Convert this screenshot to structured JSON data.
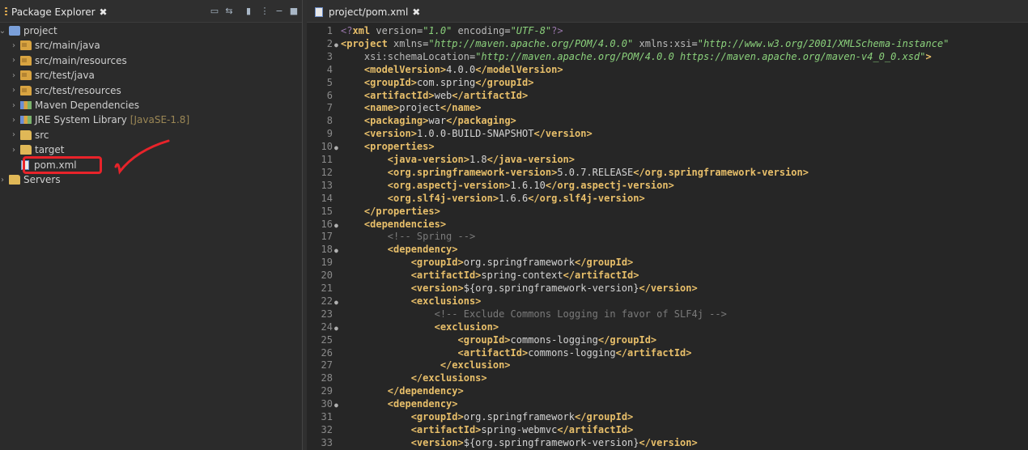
{
  "left_tab": {
    "title": "Package Explorer",
    "close": "✖"
  },
  "tree": [
    {
      "label": "project",
      "level": 0,
      "chev": "⌄",
      "icon": "project-icon"
    },
    {
      "label": "src/main/java",
      "level": 1,
      "chev": "›",
      "icon": "package-folder-icon"
    },
    {
      "label": "src/main/resources",
      "level": 1,
      "chev": "›",
      "icon": "package-folder-icon"
    },
    {
      "label": "src/test/java",
      "level": 1,
      "chev": "›",
      "icon": "package-folder-icon"
    },
    {
      "label": "src/test/resources",
      "level": 1,
      "chev": "›",
      "icon": "package-folder-icon"
    },
    {
      "label": "Maven Dependencies",
      "level": 1,
      "chev": "›",
      "icon": "library-icon"
    },
    {
      "label": "JRE System Library",
      "level": 1,
      "chev": "›",
      "icon": "library-icon",
      "suffix": "[JavaSE-1.8]"
    },
    {
      "label": "src",
      "level": 1,
      "chev": "›",
      "icon": "folder-icon"
    },
    {
      "label": "target",
      "level": 1,
      "chev": "›",
      "icon": "folder-icon"
    },
    {
      "label": "pom.xml",
      "level": 1,
      "chev": "",
      "icon": "xml-file-icon"
    },
    {
      "label": "Servers",
      "level": 0,
      "chev": "›",
      "icon": "servers-folder-icon"
    }
  ],
  "editor_tab": {
    "title": "project/pom.xml",
    "close": "✖"
  },
  "code_lines": [
    {
      "n": "1",
      "fold": false,
      "html": "<span class='pi'>&lt;?</span><span class='xl'>xml</span> <span class='a'>version</span>=<span class='v'>\"1.0\"</span> <span class='a'>encoding</span>=<span class='v'>\"UTF-8\"</span><span class='pi'>?&gt;</span>"
    },
    {
      "n": "2",
      "fold": true,
      "html": "<span class='t'>&lt;project</span> <span class='a'>xmlns</span>=<span class='v'>\"http://maven.apache.org/POM/4.0.0\"</span> <span class='a'>xmlns:xsi</span>=<span class='v'>\"http://www.w3.org/2001/XMLSchema-instance\"</span>"
    },
    {
      "n": "3",
      "fold": false,
      "html": "    <span class='a'>xsi:schemaLocation</span>=<span class='v'>\"http://maven.apache.org/POM/4.0.0 https://maven.apache.org/maven-v4_0_0.xsd\"</span><span class='t'>&gt;</span>"
    },
    {
      "n": "4",
      "fold": false,
      "html": "    <span class='t'>&lt;modelVersion&gt;</span>4.0.0<span class='t'>&lt;/modelVersion&gt;</span>"
    },
    {
      "n": "5",
      "fold": false,
      "html": "    <span class='t'>&lt;groupId&gt;</span>com.spring<span class='t'>&lt;/groupId&gt;</span>"
    },
    {
      "n": "6",
      "fold": false,
      "html": "    <span class='t'>&lt;artifactId&gt;</span>web<span class='t'>&lt;/artifactId&gt;</span>"
    },
    {
      "n": "7",
      "fold": false,
      "html": "    <span class='t'>&lt;name&gt;</span>project<span class='t'>&lt;/name&gt;</span>"
    },
    {
      "n": "8",
      "fold": false,
      "html": "    <span class='t'>&lt;packaging&gt;</span>war<span class='t'>&lt;/packaging&gt;</span>"
    },
    {
      "n": "9",
      "fold": false,
      "html": "    <span class='t'>&lt;version&gt;</span>1.0.0-BUILD-SNAPSHOT<span class='t'>&lt;/version&gt;</span>"
    },
    {
      "n": "10",
      "fold": true,
      "html": "    <span class='t'>&lt;properties&gt;</span>"
    },
    {
      "n": "11",
      "fold": false,
      "html": "        <span class='t'>&lt;java-version&gt;</span>1.8<span class='t'>&lt;/java-version&gt;</span>"
    },
    {
      "n": "12",
      "fold": false,
      "html": "        <span class='t'>&lt;org.springframework-version&gt;</span>5.0.7.RELEASE<span class='t'>&lt;/org.springframework-version&gt;</span>"
    },
    {
      "n": "13",
      "fold": false,
      "html": "        <span class='t'>&lt;org.aspectj-version&gt;</span>1.6.10<span class='t'>&lt;/org.aspectj-version&gt;</span>"
    },
    {
      "n": "14",
      "fold": false,
      "html": "        <span class='t'>&lt;org.slf4j-version&gt;</span>1.6.6<span class='t'>&lt;/org.slf4j-version&gt;</span>"
    },
    {
      "n": "15",
      "fold": false,
      "html": "    <span class='t'>&lt;/properties&gt;</span>"
    },
    {
      "n": "16",
      "fold": true,
      "html": "    <span class='t'>&lt;dependencies&gt;</span>"
    },
    {
      "n": "17",
      "fold": false,
      "html": "        <span class='c'>&lt;!-- Spring --&gt;</span>"
    },
    {
      "n": "18",
      "fold": true,
      "html": "        <span class='t'>&lt;dependency&gt;</span>"
    },
    {
      "n": "19",
      "fold": false,
      "html": "            <span class='t'>&lt;groupId&gt;</span>org.springframework<span class='t'>&lt;/groupId&gt;</span>"
    },
    {
      "n": "20",
      "fold": false,
      "html": "            <span class='t'>&lt;artifactId&gt;</span>spring-context<span class='t'>&lt;/artifactId&gt;</span>"
    },
    {
      "n": "21",
      "fold": false,
      "html": "            <span class='t'>&lt;version&gt;</span>${org.springframework-version}<span class='t'>&lt;/version&gt;</span>"
    },
    {
      "n": "22",
      "fold": true,
      "html": "            <span class='t'>&lt;exclusions&gt;</span>"
    },
    {
      "n": "23",
      "fold": false,
      "html": "                <span class='c'>&lt;!-- Exclude Commons Logging in favor of SLF4j --&gt;</span>"
    },
    {
      "n": "24",
      "fold": true,
      "html": "                <span class='t'>&lt;exclusion&gt;</span>"
    },
    {
      "n": "25",
      "fold": false,
      "html": "                    <span class='t'>&lt;groupId&gt;</span>commons-logging<span class='t'>&lt;/groupId&gt;</span>"
    },
    {
      "n": "26",
      "fold": false,
      "html": "                    <span class='t'>&lt;artifactId&gt;</span>commons-logging<span class='t'>&lt;/artifactId&gt;</span>"
    },
    {
      "n": "27",
      "fold": false,
      "html": "                 <span class='t'>&lt;/exclusion&gt;</span>"
    },
    {
      "n": "28",
      "fold": false,
      "html": "            <span class='t'>&lt;/exclusions&gt;</span>"
    },
    {
      "n": "29",
      "fold": false,
      "html": "        <span class='t'>&lt;/dependency&gt;</span>"
    },
    {
      "n": "30",
      "fold": true,
      "html": "        <span class='t'>&lt;dependency&gt;</span>"
    },
    {
      "n": "31",
      "fold": false,
      "html": "            <span class='t'>&lt;groupId&gt;</span>org.springframework<span class='t'>&lt;/groupId&gt;</span>"
    },
    {
      "n": "32",
      "fold": false,
      "html": "            <span class='t'>&lt;artifactId&gt;</span>spring-webmvc<span class='t'>&lt;/artifactId&gt;</span>"
    },
    {
      "n": "33",
      "fold": false,
      "html": "            <span class='t'>&lt;version&gt;</span>${org.springframework-version}<span class='t'>&lt;/version&gt;</span>"
    }
  ]
}
